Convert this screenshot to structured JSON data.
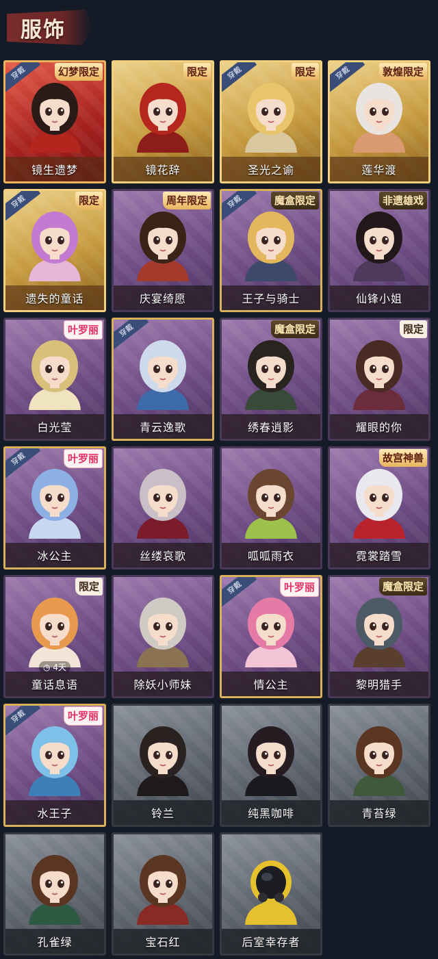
{
  "header": {
    "title": "服饰"
  },
  "labels": {
    "wear": "穿戴"
  },
  "colors": {
    "background": "#141a26",
    "banner": "#7a2c2c",
    "rarity_red": "#c23a2e",
    "rarity_gold": "#c69a3e",
    "rarity_purple": "#6e4c84",
    "rarity_gray": "#5e646e"
  },
  "costumes": [
    {
      "name": "镜生遗梦",
      "rarity": "red",
      "equipped": true,
      "badge": "幻梦限定",
      "hair": "#2a1b18",
      "outfit": "#b3261e"
    },
    {
      "name": "镜花辞",
      "rarity": "gold",
      "equipped": false,
      "badge": "限定",
      "hair": "#b4261e",
      "outfit": "#8c1d19"
    },
    {
      "name": "圣光之谕",
      "rarity": "gold",
      "equipped": true,
      "badge": "限定",
      "hair": "#e8c56a",
      "outfit": "#d9c7a0"
    },
    {
      "name": "莲华渡",
      "rarity": "gold",
      "equipped": true,
      "badge": "敦煌限定",
      "hair": "#e9e4df",
      "outfit": "#d99a72"
    },
    {
      "name": "遗失的童话",
      "rarity": "gold",
      "equipped": true,
      "badge": "限定",
      "hair": "#c37ad0",
      "outfit": "#e6b7d8"
    },
    {
      "name": "庆宴绮愿",
      "rarity": "purple",
      "equipped": false,
      "badge": "周年限定",
      "hair": "#3a2418",
      "outfit": "#a33a2c"
    },
    {
      "name": "王子与骑士",
      "rarity": "purple",
      "equipped": true,
      "badge": "魔盒限定",
      "hair": "#e3b75e",
      "outfit": "#3e4a6b"
    },
    {
      "name": "仙锋小姐",
      "rarity": "purple",
      "equipped": false,
      "badge": "非遗雄戏",
      "hair": "#231819",
      "outfit": "#4d3a5c"
    },
    {
      "name": "白光莹",
      "rarity": "purple",
      "equipped": false,
      "badge": "叶罗丽",
      "hair": "#d9c07a",
      "outfit": "#f0e3c0"
    },
    {
      "name": "青云逸歌",
      "rarity": "purple",
      "equipped": true,
      "badge": "",
      "hair": "#cfd9ec",
      "outfit": "#3d6aa8"
    },
    {
      "name": "绣春逍影",
      "rarity": "purple",
      "equipped": false,
      "badge": "魔盒限定",
      "hair": "#2a2420",
      "outfit": "#3a4a3a"
    },
    {
      "name": "耀眼的你",
      "rarity": "purple",
      "equipped": false,
      "badge": "限定",
      "hair": "#4a2a24",
      "outfit": "#6b2c3c"
    },
    {
      "name": "冰公主",
      "rarity": "purple",
      "equipped": true,
      "badge": "叶罗丽",
      "hair": "#8db0e4",
      "outfit": "#c8d8f0"
    },
    {
      "name": "丝缕哀歌",
      "rarity": "purple",
      "equipped": false,
      "badge": "",
      "hair": "#c9bfc6",
      "outfit": "#7a1c2a"
    },
    {
      "name": "呱呱雨衣",
      "rarity": "purple",
      "equipped": false,
      "badge": "",
      "hair": "#6a4530",
      "outfit": "#9cc24c"
    },
    {
      "name": "霓裳踏雪",
      "rarity": "purple",
      "equipped": false,
      "badge": "故宫神兽",
      "hair": "#e8e8ee",
      "outfit": "#b8242e"
    },
    {
      "name": "童话息语",
      "rarity": "purple",
      "equipped": false,
      "badge": "限定",
      "hair": "#e79a4e",
      "outfit": "#f2e4d6",
      "timer": "4天"
    },
    {
      "name": "除妖小师妹",
      "rarity": "purple",
      "equipped": false,
      "badge": "",
      "hair": "#cfcac4",
      "outfit": "#8a7252"
    },
    {
      "name": "情公主",
      "rarity": "purple",
      "equipped": true,
      "badge": "叶罗丽",
      "hair": "#e67aa6",
      "outfit": "#f3c3d6"
    },
    {
      "name": "黎明猎手",
      "rarity": "purple",
      "equipped": false,
      "badge": "魔盒限定",
      "hair": "#4d5a66",
      "outfit": "#5a3e2e"
    },
    {
      "name": "水王子",
      "rarity": "purple",
      "equipped": true,
      "badge": "叶罗丽",
      "hair": "#7fc0e8",
      "outfit": "#3d7fb8"
    },
    {
      "name": "铃兰",
      "rarity": "gray",
      "equipped": false,
      "badge": "",
      "hair": "#2a2220",
      "outfit": "#1e1a1c"
    },
    {
      "name": "纯黑咖啡",
      "rarity": "gray",
      "equipped": false,
      "badge": "",
      "hair": "#241c20",
      "outfit": "#1a1a1e"
    },
    {
      "name": "青苔绿",
      "rarity": "gray",
      "equipped": false,
      "badge": "",
      "hair": "#5a3622",
      "outfit": "#3e5a3a"
    },
    {
      "name": "孔雀绿",
      "rarity": "gray",
      "equipped": false,
      "badge": "",
      "hair": "#5a3622",
      "outfit": "#2e5a44"
    },
    {
      "name": "宝石红",
      "rarity": "gray",
      "equipped": false,
      "badge": "",
      "hair": "#5a3622",
      "outfit": "#8a2a24"
    },
    {
      "name": "后室幸存者",
      "rarity": "gray",
      "equipped": false,
      "badge": "",
      "hair": "#e6c12e",
      "outfit": "#e6c12e",
      "masked": true
    }
  ]
}
